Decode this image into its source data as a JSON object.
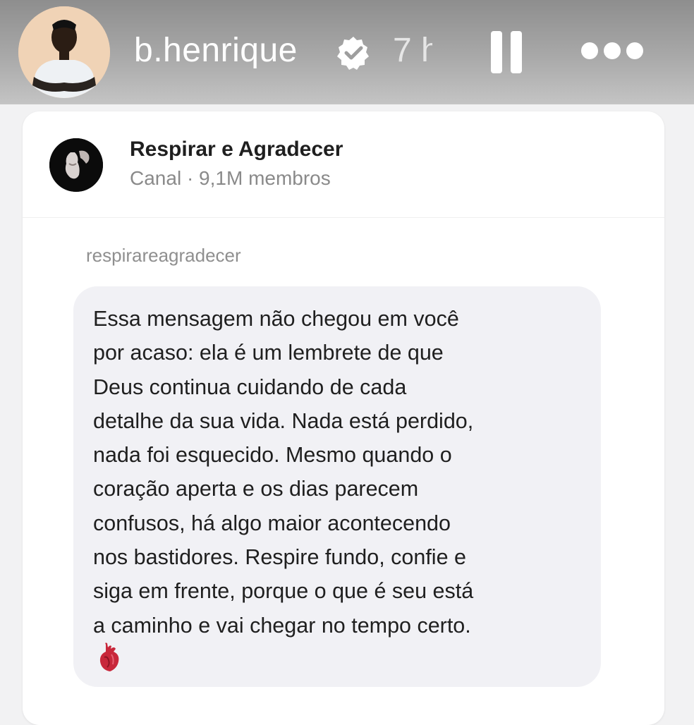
{
  "story": {
    "username": "b.henrique",
    "time": "7 h",
    "verified_icon": "verified-badge-icon",
    "pause_icon": "pause-icon",
    "more_icon": "more-options-icon"
  },
  "channel": {
    "name": "Respirar e Agradecer",
    "meta": "Canal · 9,1M membros"
  },
  "post": {
    "sender": "respirareagradecer",
    "message": "Essa mensagem não chegou em você\npor acaso: ela é um lembrete de que\nDeus continua cuidando de cada\ndetalhe da sua vida. Nada está perdido,\nnada foi esquecido. Mesmo quando o\ncoração aperta e os dias parecem\nconfusos, há algo maior acontecendo\nnos bastidores. Respire fundo, confie e\nsiga em frente, porque o que é seu está\na caminho e vai chegar no tempo certo.",
    "emoji_icon": "anatomical-heart-icon"
  },
  "colors": {
    "header_bg": "#a9a9a9",
    "card_bg": "#ffffff",
    "bubble_bg": "#f1f1f5",
    "text_primary": "#1f1f1f",
    "text_secondary": "#8a8a8a"
  }
}
